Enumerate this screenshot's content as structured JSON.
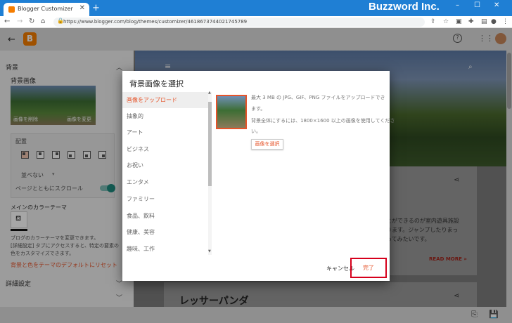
{
  "browser": {
    "tab_title": "Blogger Customizer",
    "tab_close": "✕",
    "new_tab": "+",
    "brand": "Buzzword Inc.",
    "url": "https://www.blogger.com/blog/themes/customizer/4618673744021745789",
    "win_min": "–",
    "win_max": "☐",
    "win_close": "✕"
  },
  "app": {
    "logo": "B"
  },
  "sidebar": {
    "section_bg": "背景",
    "bg_image_label": "背景画像",
    "thumb_remove": "画像を削除",
    "thumb_change": "画像を変更",
    "placement_label": "配置",
    "tile_select": "並べない",
    "scroll_label": "ページとともにスクロール",
    "main_color_label": "メインのカラーテーマ",
    "desc_line1": "ブログのカラーテーマを変更できます。",
    "desc_line2": "[詳細設定] タブにアクセスすると、特定の要素の",
    "desc_line3": "色をカスタマイズできます。",
    "reset_link": "背景と色をテーマのデフォルトにリセット",
    "detail_label": "詳細設定"
  },
  "main": {
    "read_more": "READ MORE »",
    "snippet1": "とができるのが室内遊具施設",
    "snippet2": "ります。ジャンプしたりまっ",
    "snippet3": "ってみたいです。",
    "heading2": "レッサーパンダ"
  },
  "dialog": {
    "title": "背景画像を選択",
    "categories": [
      "画像をアップロード",
      "抽象的",
      "アート",
      "ビジネス",
      "お祝い",
      "エンタメ",
      "ファミリー",
      "食品、飲料",
      "健康、美容",
      "趣味、工作"
    ],
    "info_line1": "最大 3 MB の JPG、GIF、PNG ファイルをアップロードでき",
    "info_line2": "ます。",
    "info_line3": "背景全体にするには、1800×1600 以上の画像を使用してくださ",
    "info_line4": "い。",
    "pick_button": "画像を選択",
    "cancel": "キャンセル",
    "done": "完了"
  },
  "colors": {
    "accent": "#e6542a",
    "chrome": "#1f7fd4",
    "highlight": "#d6001c"
  }
}
